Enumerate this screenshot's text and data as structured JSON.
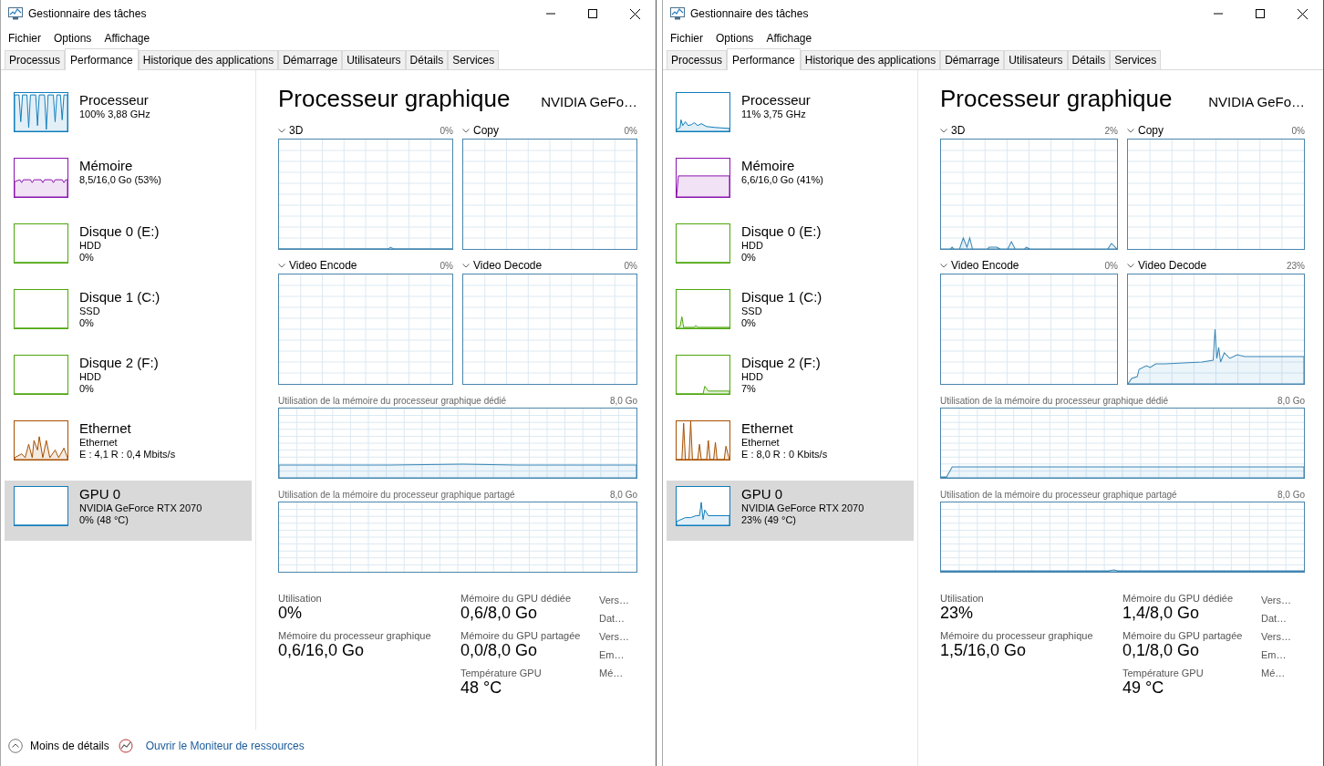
{
  "windows": [
    {
      "title": "Gestionnaire des tâches",
      "menu": [
        "Fichier",
        "Options",
        "Affichage"
      ],
      "tabs": [
        {
          "label": "Processus",
          "selected": false
        },
        {
          "label": "Performance",
          "selected": true
        },
        {
          "label": "Historique des applications",
          "selected": false
        },
        {
          "label": "Démarrage",
          "selected": false
        },
        {
          "label": "Utilisateurs",
          "selected": false
        },
        {
          "label": "Détails",
          "selected": false
        },
        {
          "label": "Services",
          "selected": false
        }
      ],
      "sidebar": [
        {
          "name": "Processeur",
          "lines": [
            "100% 3,88 GHz"
          ],
          "color": "#117dbb",
          "selected": false
        },
        {
          "name": "Mémoire",
          "lines": [
            "8,5/16,0 Go (53%)"
          ],
          "color": "#8b12ae",
          "selected": false
        },
        {
          "name": "Disque 0 (E:)",
          "lines": [
            "HDD",
            "0%"
          ],
          "color": "#4da60c",
          "selected": false
        },
        {
          "name": "Disque 1 (C:)",
          "lines": [
            "SSD",
            "0%"
          ],
          "color": "#4da60c",
          "selected": false
        },
        {
          "name": "Disque 2 (F:)",
          "lines": [
            "HDD",
            "0%"
          ],
          "color": "#4da60c",
          "selected": false
        },
        {
          "name": "Ethernet",
          "lines": [
            "Ethernet",
            "E : 4,1 R : 0,4 Mbits/s"
          ],
          "color": "#a74f01",
          "selected": false
        },
        {
          "name": "GPU 0",
          "lines": [
            "NVIDIA GeForce RTX 2070",
            "0% (48 °C)"
          ],
          "color": "#117dbb",
          "selected": true
        }
      ],
      "heading": "Processeur graphique",
      "device": "NVIDIA GeFo…",
      "engines": [
        {
          "name": "3D",
          "value": "0%"
        },
        {
          "name": "Copy",
          "value": "0%"
        },
        {
          "name": "Video Encode",
          "value": "0%"
        },
        {
          "name": "Video Decode",
          "value": "0%"
        }
      ],
      "memory_graphs": [
        {
          "label": "Utilisation de la mémoire du processeur graphique dédié",
          "max": "8,0 Go"
        },
        {
          "label": "Utilisation de la mémoire du processeur graphique partagé",
          "max": "8,0 Go"
        }
      ],
      "stats": [
        [
          {
            "label": "Utilisation",
            "value": "0%"
          },
          {
            "label": "Mémoire du processeur graphique",
            "value": "0,6/16,0 Go"
          }
        ],
        [
          {
            "label": "Mémoire du GPU dédiée",
            "value": "0,6/8,0 Go"
          },
          {
            "label": "Mémoire du GPU partagée",
            "value": "0,0/8,0 Go"
          },
          {
            "label": "Température GPU",
            "value": "48 °C"
          }
        ]
      ],
      "details": [
        "Vers…",
        "Dat…",
        "Vers…",
        "Em…",
        "Mé…"
      ],
      "footer": {
        "less_details": "Moins de détails",
        "monitor_link": "Ouvrir le Moniteur de ressources"
      }
    },
    {
      "title": "Gestionnaire des tâches",
      "menu": [
        "Fichier",
        "Options",
        "Affichage"
      ],
      "tabs": [
        {
          "label": "Processus",
          "selected": false
        },
        {
          "label": "Performance",
          "selected": true
        },
        {
          "label": "Historique des applications",
          "selected": false
        },
        {
          "label": "Démarrage",
          "selected": false
        },
        {
          "label": "Utilisateurs",
          "selected": false
        },
        {
          "label": "Détails",
          "selected": false
        },
        {
          "label": "Services",
          "selected": false
        }
      ],
      "sidebar": [
        {
          "name": "Processeur",
          "lines": [
            "11% 3,75 GHz"
          ],
          "color": "#117dbb",
          "selected": false
        },
        {
          "name": "Mémoire",
          "lines": [
            "6,6/16,0 Go (41%)"
          ],
          "color": "#8b12ae",
          "selected": false
        },
        {
          "name": "Disque 0 (E:)",
          "lines": [
            "HDD",
            "0%"
          ],
          "color": "#4da60c",
          "selected": false
        },
        {
          "name": "Disque 1 (C:)",
          "lines": [
            "SSD",
            "0%"
          ],
          "color": "#4da60c",
          "selected": false
        },
        {
          "name": "Disque 2 (F:)",
          "lines": [
            "HDD",
            "7%"
          ],
          "color": "#4da60c",
          "selected": false
        },
        {
          "name": "Ethernet",
          "lines": [
            "Ethernet",
            "E : 8,0 R : 0 Kbits/s"
          ],
          "color": "#a74f01",
          "selected": false
        },
        {
          "name": "GPU 0",
          "lines": [
            "NVIDIA GeForce RTX 2070",
            "23% (49 °C)"
          ],
          "color": "#117dbb",
          "selected": true
        }
      ],
      "heading": "Processeur graphique",
      "device": "NVIDIA GeFo…",
      "engines": [
        {
          "name": "3D",
          "value": "2%"
        },
        {
          "name": "Copy",
          "value": "0%"
        },
        {
          "name": "Video Encode",
          "value": "0%"
        },
        {
          "name": "Video Decode",
          "value": "23%"
        }
      ],
      "memory_graphs": [
        {
          "label": "Utilisation de la mémoire du processeur graphique dédié",
          "max": "8,0 Go"
        },
        {
          "label": "Utilisation de la mémoire du processeur graphique partagé",
          "max": "8,0 Go"
        }
      ],
      "stats": [
        [
          {
            "label": "Utilisation",
            "value": "23%"
          },
          {
            "label": "Mémoire du processeur graphique",
            "value": "1,5/16,0 Go"
          }
        ],
        [
          {
            "label": "Mémoire du GPU dédiée",
            "value": "1,4/8,0 Go"
          },
          {
            "label": "Mémoire du GPU partagée",
            "value": "0,1/8,0 Go"
          },
          {
            "label": "Température GPU",
            "value": "49 °C"
          }
        ]
      ],
      "details": [
        "Vers…",
        "Dat…",
        "Vers…",
        "Em…",
        "Mé…"
      ]
    }
  ]
}
